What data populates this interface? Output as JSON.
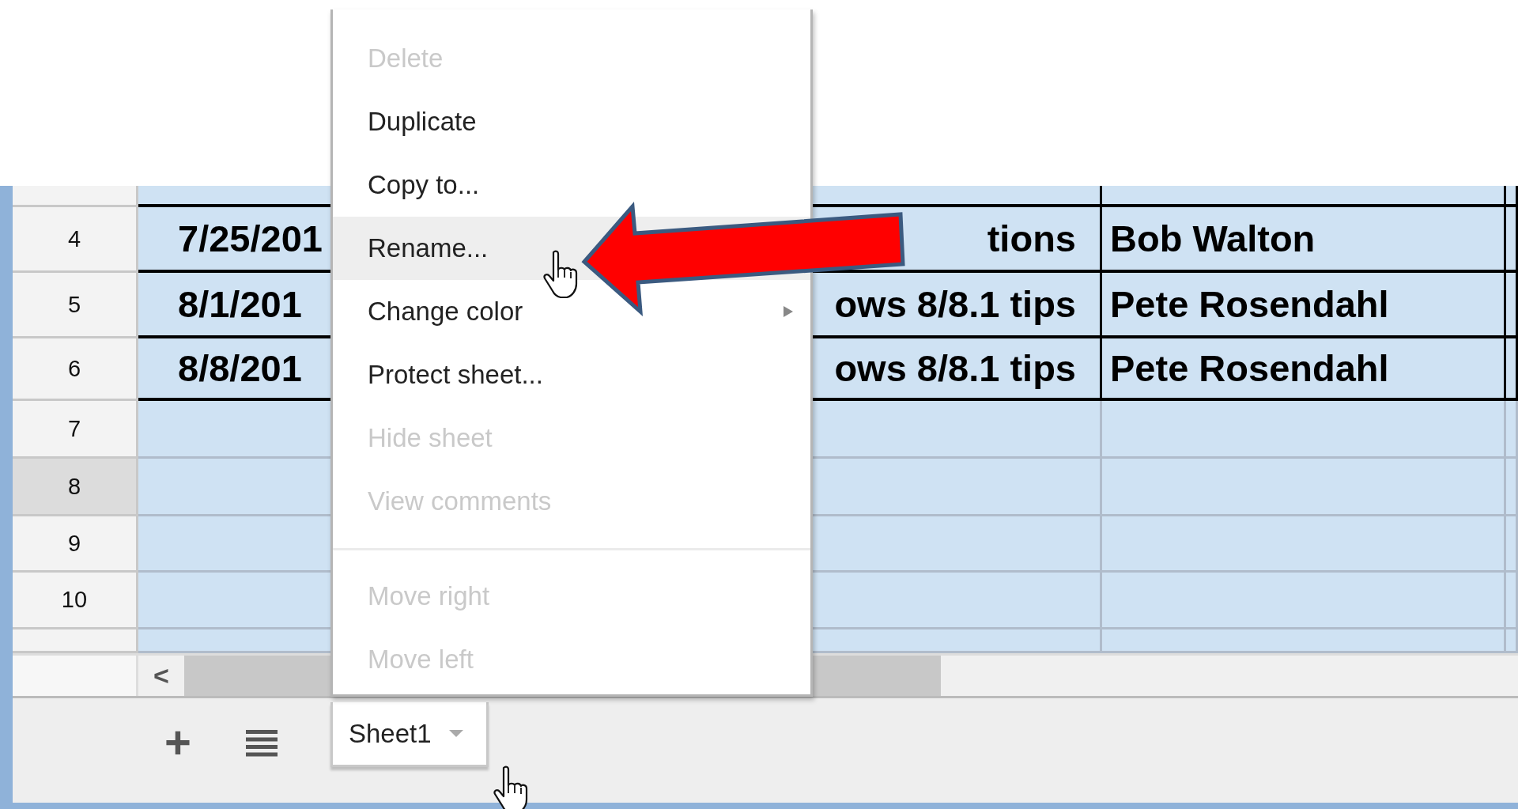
{
  "grid": {
    "rows": [
      {
        "header": "4",
        "selected": false,
        "bordered": true,
        "cells": [
          "7/25/201",
          "tions",
          "Bob Walton"
        ]
      },
      {
        "header": "5",
        "selected": false,
        "bordered": true,
        "cells": [
          "8/1/201",
          "ows 8/8.1 tips",
          "Pete Rosendahl"
        ]
      },
      {
        "header": "6",
        "selected": false,
        "bordered": true,
        "cells": [
          "8/8/201",
          "ows 8/8.1 tips",
          "Pete Rosendahl"
        ]
      },
      {
        "header": "7",
        "selected": false,
        "bordered": false,
        "cells": []
      },
      {
        "header": "8",
        "selected": true,
        "bordered": false,
        "cells": []
      },
      {
        "header": "9",
        "selected": false,
        "bordered": false,
        "cells": []
      },
      {
        "header": "10",
        "selected": false,
        "bordered": false,
        "cells": []
      }
    ],
    "scroll_left": "<"
  },
  "context_menu": {
    "items": [
      {
        "kind": "item",
        "label": "Delete",
        "disabled": true,
        "selected": false,
        "submenu": false
      },
      {
        "kind": "item",
        "label": "Duplicate",
        "disabled": false,
        "selected": false,
        "submenu": false
      },
      {
        "kind": "item",
        "label": "Copy to...",
        "disabled": false,
        "selected": false,
        "submenu": false
      },
      {
        "kind": "item",
        "label": "Rename...",
        "disabled": false,
        "selected": true,
        "submenu": false
      },
      {
        "kind": "item",
        "label": "Change color",
        "disabled": false,
        "selected": false,
        "submenu": true
      },
      {
        "kind": "item",
        "label": "Protect sheet...",
        "disabled": false,
        "selected": false,
        "submenu": false
      },
      {
        "kind": "item",
        "label": "Hide sheet",
        "disabled": true,
        "selected": false,
        "submenu": false
      },
      {
        "kind": "item",
        "label": "View comments",
        "disabled": true,
        "selected": false,
        "submenu": false
      },
      {
        "kind": "separator"
      },
      {
        "kind": "item",
        "label": "Move right",
        "disabled": true,
        "selected": false,
        "submenu": false
      },
      {
        "kind": "item",
        "label": "Move left",
        "disabled": true,
        "selected": false,
        "submenu": false
      }
    ]
  },
  "sheet_bar": {
    "add": "+",
    "tabs": [
      {
        "label": "Sheet1",
        "selected": true
      }
    ]
  }
}
